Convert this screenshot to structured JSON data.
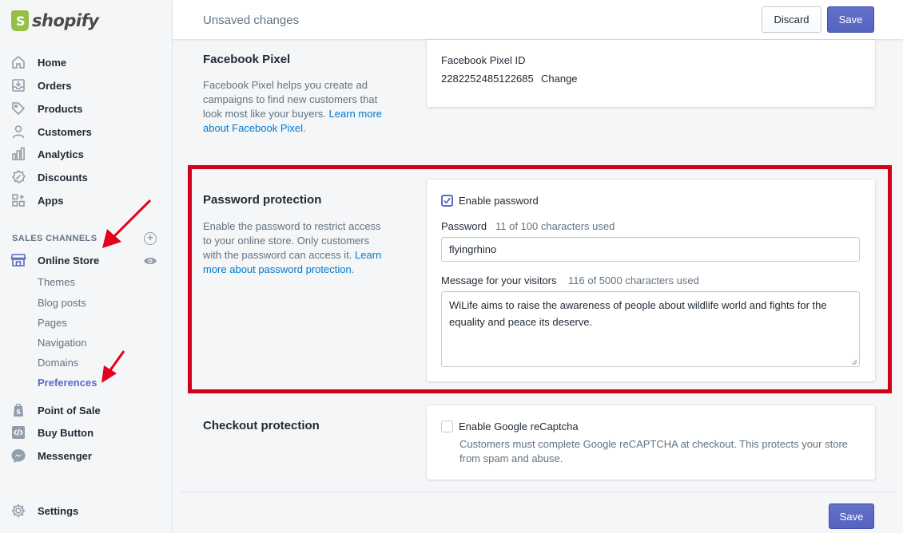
{
  "brand": {
    "name": "shopify"
  },
  "sidebar": {
    "items": [
      {
        "label": "Home",
        "icon": "home-icon"
      },
      {
        "label": "Orders",
        "icon": "orders-icon"
      },
      {
        "label": "Products",
        "icon": "tag-icon"
      },
      {
        "label": "Customers",
        "icon": "person-icon"
      },
      {
        "label": "Analytics",
        "icon": "bar-chart-icon"
      },
      {
        "label": "Discounts",
        "icon": "discount-icon"
      },
      {
        "label": "Apps",
        "icon": "apps-icon"
      }
    ],
    "sales_channels_label": "SALES CHANNELS",
    "online_store": {
      "label": "Online Store",
      "subitems": [
        "Themes",
        "Blog posts",
        "Pages",
        "Navigation",
        "Domains",
        "Preferences"
      ],
      "active_subitem": "Preferences"
    },
    "channels": [
      {
        "label": "Point of Sale",
        "icon": "pos-bag-icon"
      },
      {
        "label": "Buy Button",
        "icon": "code-icon"
      },
      {
        "label": "Messenger",
        "icon": "messenger-icon"
      }
    ],
    "settings_label": "Settings"
  },
  "topbar": {
    "title": "Unsaved changes",
    "discard_label": "Discard",
    "save_label": "Save"
  },
  "facebook_pixel": {
    "title": "Facebook Pixel",
    "desc_text": "Facebook Pixel helps you create ad campaigns to find new customers that look most like your buyers.",
    "desc_link": "Learn more about Facebook Pixel",
    "field_label": "Facebook Pixel ID",
    "field_value": "2282252485122685",
    "change_link": "Change"
  },
  "password_protection": {
    "title": "Password protection",
    "desc_text": "Enable the password to restrict access to your online store. Only customers with the password can access it.",
    "desc_link": "Learn more about password protection",
    "enable_label": "Enable password",
    "enabled": true,
    "password_label": "Password",
    "password_count": "11 of 100 characters used",
    "password_value": "flyingrhino",
    "message_label": "Message for your visitors",
    "message_count": "116 of 5000 characters used",
    "message_value": "WiLife aims to raise the awareness of people about wildlife world and fights for the equality and peace its deserve."
  },
  "checkout_protection": {
    "title": "Checkout protection",
    "recaptcha_label": "Enable Google reCaptcha",
    "enabled": false,
    "recaptcha_help": "Customers must complete Google reCAPTCHA at checkout. This protects your store from spam and abuse."
  },
  "footer": {
    "save_label": "Save"
  },
  "colors": {
    "accent": "#5c6ac4",
    "link": "#007ace",
    "highlight": "#d0021b",
    "annotation_arrow": "#e5001c",
    "brand_green": "#95bf47"
  }
}
